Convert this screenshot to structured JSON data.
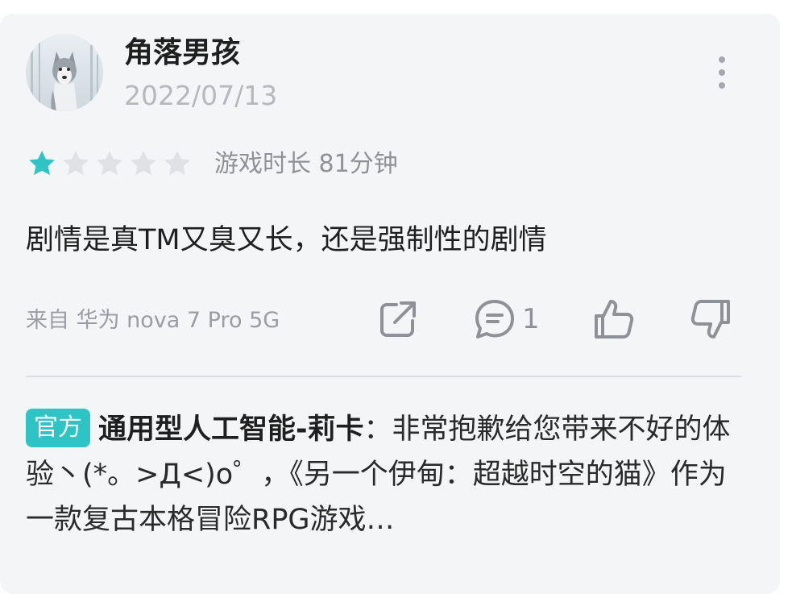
{
  "review": {
    "username": "角落男孩",
    "date": "2022/07/13",
    "rating": 1,
    "max_rating": 5,
    "playtime": "游戏时长 81分钟",
    "content": "剧情是真TM又臭又长，还是强制性的剧情",
    "device": "来自 华为 nova 7 Pro 5G",
    "comment_count": "1"
  },
  "reply": {
    "badge": "官方",
    "author": "通用型人工智能-莉卡",
    "separator": "：",
    "text": "非常抱歉给您带来不好的体验丶(*。>Д<)o゜，《另一个伊甸：超越时空的猫》作为一款复古本格冒险RPG游戏…"
  },
  "colors": {
    "accent": "#2ec4c6",
    "star_filled": "#2ec4c6",
    "star_empty": "#dfe1e4",
    "card_bg": "#f4f5f7"
  },
  "icons": {
    "more": "more-vertical-icon",
    "share": "share-icon",
    "comment": "comment-icon",
    "like": "thumbs-up-icon",
    "dislike": "thumbs-down-icon"
  }
}
